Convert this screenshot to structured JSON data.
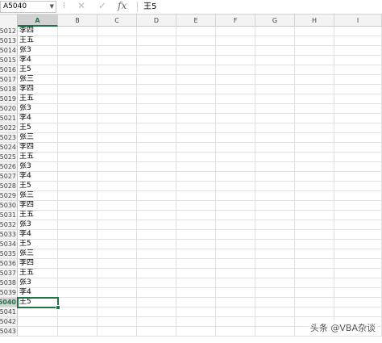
{
  "formula_bar": {
    "name_box": "A5040",
    "name_box_arrow": "▼",
    "separator": "⁝",
    "cancel_glyph": "✕",
    "enter_glyph": "✓",
    "fx_label": "fx",
    "value": "王5"
  },
  "columns": [
    "A",
    "B",
    "C",
    "D",
    "E",
    "F",
    "G",
    "H",
    "I"
  ],
  "active_column": "A",
  "rows": [
    {
      "num": "5012",
      "a": "李四"
    },
    {
      "num": "5013",
      "a": "王五"
    },
    {
      "num": "5014",
      "a": "张3"
    },
    {
      "num": "5015",
      "a": "李4"
    },
    {
      "num": "5016",
      "a": "王5"
    },
    {
      "num": "5017",
      "a": "张三"
    },
    {
      "num": "5018",
      "a": "李四"
    },
    {
      "num": "5019",
      "a": "王五"
    },
    {
      "num": "5020",
      "a": "张3"
    },
    {
      "num": "5021",
      "a": "李4"
    },
    {
      "num": "5022",
      "a": "王5"
    },
    {
      "num": "5023",
      "a": "张三"
    },
    {
      "num": "5024",
      "a": "李四"
    },
    {
      "num": "5025",
      "a": "王五"
    },
    {
      "num": "5026",
      "a": "张3"
    },
    {
      "num": "5027",
      "a": "李4"
    },
    {
      "num": "5028",
      "a": "王5"
    },
    {
      "num": "5029",
      "a": "张三"
    },
    {
      "num": "5030",
      "a": "李四"
    },
    {
      "num": "5031",
      "a": "王五"
    },
    {
      "num": "5032",
      "a": "张3"
    },
    {
      "num": "5033",
      "a": "李4"
    },
    {
      "num": "5034",
      "a": "王5"
    },
    {
      "num": "5035",
      "a": "张三"
    },
    {
      "num": "5036",
      "a": "李四"
    },
    {
      "num": "5037",
      "a": "王五"
    },
    {
      "num": "5038",
      "a": "张3"
    },
    {
      "num": "5039",
      "a": "李4"
    },
    {
      "num": "5040",
      "a": "王5"
    },
    {
      "num": "5041",
      "a": ""
    },
    {
      "num": "5042",
      "a": ""
    },
    {
      "num": "5043",
      "a": ""
    }
  ],
  "selected_row": "5040",
  "watermark": "头条 @VBA杂谈",
  "colors": {
    "accent": "#217346"
  }
}
